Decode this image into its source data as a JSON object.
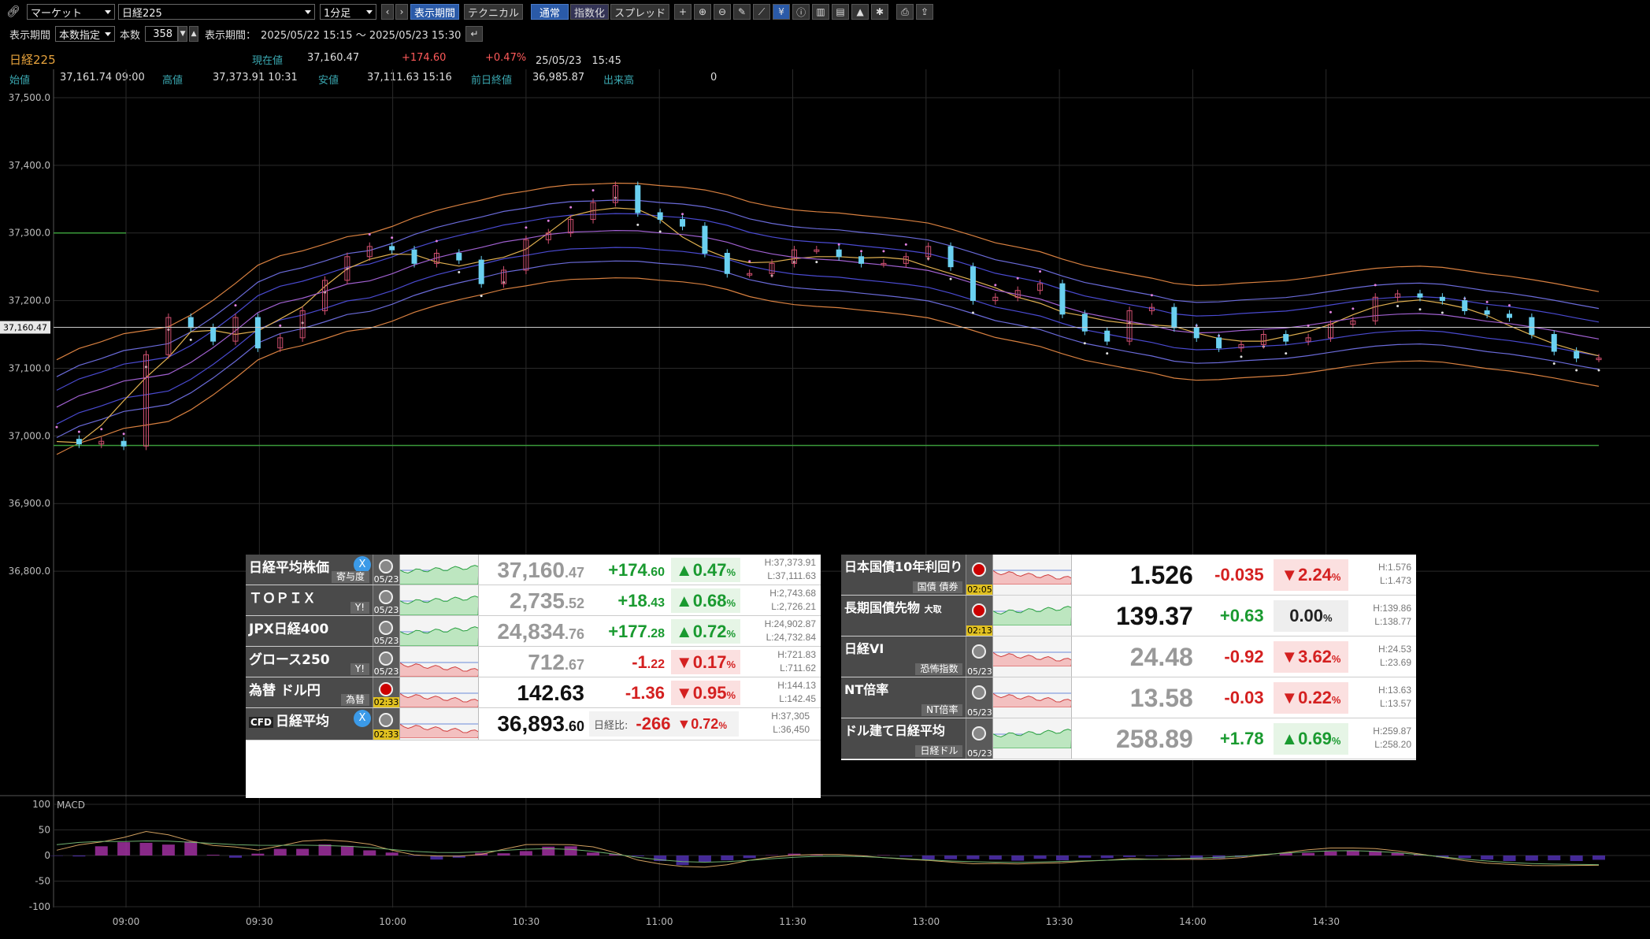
{
  "toolbar": {
    "market_select": "マーケット",
    "symbol_select": "日経225",
    "interval_select": "1分足",
    "display_period_btn": "表示期間",
    "technical_btn": "テクニカル",
    "normal_btn": "通常",
    "index_btn": "指数化",
    "spread_btn": "スプレッド"
  },
  "period": {
    "label": "表示期間",
    "mode_select": "本数指定",
    "count_label": "本数",
    "count_value": "358",
    "range_label": "表示期間：",
    "range_value": "2025/05/22 15:15 ～ 2025/05/23 15:30"
  },
  "quote": {
    "name": "日経225",
    "current_label": "現在値",
    "current": "37,160.47",
    "change": "+174.60",
    "change_pct": "+0.47%",
    "datetime": "25/05/23　15:45",
    "open_label": "始値",
    "open": "37,161.74  09:00",
    "high_label": "高値",
    "high": "37,373.91  10:31",
    "low_label": "安値",
    "low": "37,111.63  15:16",
    "prev_label": "前日終値",
    "prev": "36,985.87",
    "volume_label": "出来高",
    "volume": "0"
  },
  "chart_data": {
    "type": "candlestick",
    "y_ticks": [
      "37,500.0",
      "37,400.0",
      "37,300.0",
      "37,200.0",
      "37,100.0",
      "37,000.0",
      "36,900.0",
      "36,800.0"
    ],
    "ylim": [
      36750,
      37500
    ],
    "x_ticks": [
      "09:00",
      "09:30",
      "10:00",
      "10:30",
      "11:00",
      "11:30",
      "13:00",
      "13:30",
      "14:00",
      "14:30"
    ],
    "current_price_label": "37,160.47",
    "current_price": 37160.47,
    "macd_label": "MACD",
    "macd_ticks": [
      "100",
      "50",
      "0",
      "-50",
      "-100"
    ],
    "macd_ylim": [
      -100,
      100
    ],
    "close_series_approx": [
      36995,
      36988,
      36992,
      36985,
      37120,
      37175,
      37160,
      37140,
      37175,
      37130,
      37145,
      37185,
      37230,
      37265,
      37280,
      37275,
      37255,
      37270,
      37260,
      37225,
      37245,
      37290,
      37300,
      37320,
      37345,
      37370,
      37330,
      37320,
      37310,
      37270,
      37240,
      37240,
      37255,
      37275,
      37275,
      37265,
      37255,
      37255,
      37265,
      37280,
      37250,
      37200,
      37205,
      37215,
      37225,
      37180,
      37155,
      37140,
      37185,
      37190,
      37160,
      37145,
      37130,
      37135,
      37150,
      37140,
      37145,
      37165,
      37170,
      37205,
      37210,
      37205,
      37200,
      37185,
      37180,
      37175,
      37150,
      37125,
      37115,
      37115
    ]
  },
  "markets_left": [
    {
      "name": "日経平均株価",
      "sub": "寄与度",
      "badge": "X",
      "date": "05/23",
      "flag": "jp",
      "price_main": "37,160",
      "price_dec": ".47",
      "change": "+174",
      "change_dec": ".60",
      "dir": "up",
      "pct": "0.47",
      "pct_unit": "%",
      "high": "H:37,373.91",
      "low": "L:37,111.63",
      "price_dark": false
    },
    {
      "name": "ＴＯＰＩＸ",
      "sub": "Y!",
      "date": "05/23",
      "flag": "jp",
      "price_main": "2,735",
      "price_dec": ".52",
      "change": "+18",
      "change_dec": ".43",
      "dir": "up",
      "pct": "0.68",
      "pct_unit": "%",
      "high": "H:2,743.68",
      "low": "L:2,726.21",
      "price_dark": false
    },
    {
      "name": "JPX日経400",
      "sub": "",
      "date": "05/23",
      "flag": "jp",
      "price_main": "24,834",
      "price_dec": ".76",
      "change": "+177",
      "change_dec": ".28",
      "dir": "up",
      "pct": "0.72",
      "pct_unit": "%",
      "high": "H:24,902.87",
      "low": "L:24,732.84",
      "price_dark": false
    },
    {
      "name": "グロース250",
      "sub": "Y!",
      "date": "05/23",
      "flag": "jp",
      "price_main": "712",
      "price_dec": ".67",
      "change": "-1",
      "change_dec": ".22",
      "dir": "dn",
      "pct": "0.17",
      "pct_unit": "%",
      "high": "H:721.83",
      "low": "L:711.62",
      "price_dark": false
    },
    {
      "name": "為替 ドル円",
      "sub": "為替",
      "date": "02:33",
      "flag": "us",
      "price_main": "142.63",
      "price_dec": "",
      "change": "-1.36",
      "change_dec": "",
      "dir": "dn",
      "pct": "0.95",
      "pct_unit": "%",
      "high": "H:144.13",
      "low": "L:142.45",
      "price_dark": true
    }
  ],
  "cfd": {
    "tag": "CFD",
    "name": "日経平均",
    "badge": "X",
    "date": "02:33",
    "price_main": "36,893",
    "price_dec": ".60",
    "ratio_label": "日経比:",
    "ratio": "-266",
    "pct": "0.72",
    "pct_unit": "%",
    "high": "H:37,305",
    "low": "L:36,450"
  },
  "markets_right": [
    {
      "name": "日本国債10年利回り",
      "sub": "国債 債券",
      "date": "02:05",
      "date_style": "y",
      "price": "1.526",
      "change": "-0.035",
      "dir": "dn",
      "pct": "2.24",
      "pct_unit": "%",
      "high": "H:1.576",
      "low": "L:1.473",
      "dark": true
    },
    {
      "name": "長期国債先物",
      "name_small": "大取",
      "sub": "",
      "date": "02:13",
      "date_style": "y",
      "price": "139.37",
      "change": "+0.63",
      "dir": "up",
      "pct": "0.00",
      "pct_unit": "%",
      "pct_style": "zero",
      "high": "H:139.86",
      "low": "L:138.77",
      "dark": true
    },
    {
      "name": "日経VI",
      "sub": "恐怖指数",
      "date": "05/23",
      "date_style": "",
      "price": "24.48",
      "change": "-0.92",
      "dir": "dn",
      "pct": "3.62",
      "pct_unit": "%",
      "high": "H:24.53",
      "low": "L:23.69",
      "dark": false
    },
    {
      "name": "NT倍率",
      "sub": "NT倍率",
      "date": "05/23",
      "date_style": "",
      "price": "13.58",
      "change": "-0.03",
      "dir": "dn",
      "pct": "0.22",
      "pct_unit": "%",
      "high": "H:13.63",
      "low": "L:13.57",
      "dark": false
    },
    {
      "name": "ドル建て日経平均",
      "sub": "日経ドル",
      "date": "05/23",
      "date_style": "",
      "price": "258.89",
      "change": "+1.78",
      "dir": "up",
      "pct": "0.69",
      "pct_unit": "%",
      "high": "H:259.87",
      "low": "L:258.20",
      "dark": false
    }
  ],
  "colors": {
    "up": "#1a9a30",
    "down": "#d42020",
    "candle_up": "#d05070",
    "candle_down": "#6ad0f0",
    "accent": "#2a5aa8"
  }
}
